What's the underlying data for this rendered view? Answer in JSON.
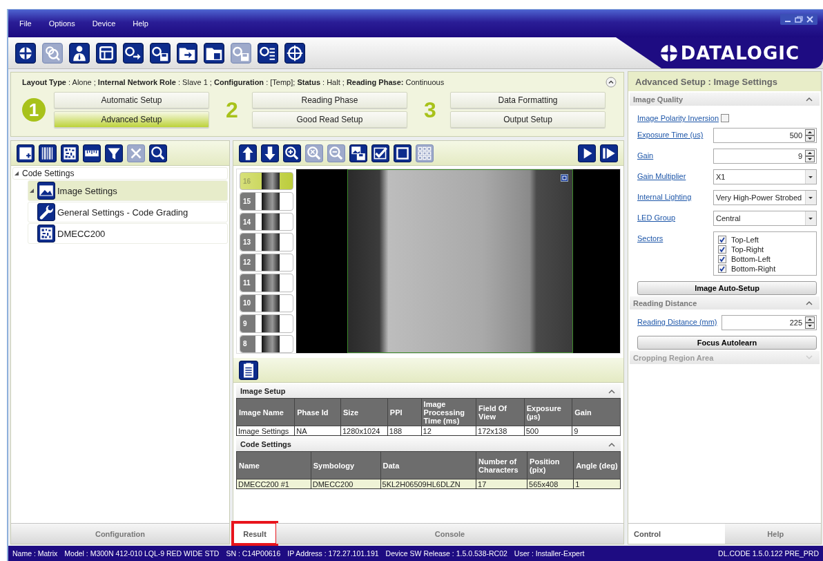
{
  "menu": [
    "File",
    "Options",
    "Device",
    "Help"
  ],
  "toolbar": [
    {
      "kind": "target",
      "disabled": false
    },
    {
      "kind": "camera-magnifier",
      "disabled": true
    },
    {
      "kind": "person",
      "disabled": false
    },
    {
      "kind": "window",
      "disabled": false
    },
    {
      "kind": "camera-arrow",
      "disabled": false
    },
    {
      "kind": "camera-disk",
      "disabled": false
    },
    {
      "kind": "folder-arrow",
      "disabled": false
    },
    {
      "kind": "folder-disk",
      "disabled": false
    },
    {
      "kind": "camera-disk",
      "disabled": true
    },
    {
      "kind": "camera-list",
      "disabled": false
    },
    {
      "kind": "crosshair",
      "disabled": false
    }
  ],
  "logo": {
    "text": "DATALOGIC"
  },
  "info_line": "**Layout Type** :  Alone ;  **Internal Network Role** :  Slave 1 ;  **Configuration** : [Temp];  **Status** :  Halt ;  **Reading Phase:** Continuous",
  "setup_steps": [
    {
      "number": "1",
      "active": true,
      "buttons": [
        {
          "label": "Automatic Setup",
          "selected": false
        },
        {
          "label": "Advanced Setup",
          "selected": true
        }
      ]
    },
    {
      "number": "2",
      "active": false,
      "buttons": [
        {
          "label": "Reading Phase",
          "selected": false
        },
        {
          "label": "Good Read Setup",
          "selected": false
        }
      ]
    },
    {
      "number": "3",
      "active": false,
      "buttons": [
        {
          "label": "Data Formatting",
          "selected": false
        },
        {
          "label": "Output Setup",
          "selected": false
        }
      ]
    }
  ],
  "config_panel": {
    "toolbar": [
      {
        "kind": "page-plus",
        "disabled": false
      },
      {
        "kind": "barcode",
        "disabled": false
      },
      {
        "kind": "matrix-code",
        "disabled": false
      },
      {
        "kind": "ruler",
        "disabled": false
      },
      {
        "kind": "funnel",
        "disabled": false
      },
      {
        "kind": "close",
        "disabled": true
      },
      {
        "kind": "magnifier",
        "disabled": false
      }
    ],
    "tree": [
      {
        "label": "Code Settings",
        "expanded": true,
        "children": [
          {
            "label": "Image Settings",
            "kind": "image",
            "selected": true,
            "expanded": true
          },
          {
            "label": "General Settings - Code Grading",
            "kind": "wrench",
            "selected": false
          },
          {
            "label": "DMECC200",
            "kind": "matrix-code",
            "selected": false
          }
        ]
      }
    ],
    "tab": "Configuration"
  },
  "viewer": {
    "toolbar": [
      {
        "kind": "arrow-up",
        "disabled": false
      },
      {
        "kind": "arrow-down",
        "disabled": false
      },
      {
        "kind": "zoom-in",
        "disabled": false
      },
      {
        "kind": "zoom-reset",
        "disabled": true
      },
      {
        "kind": "zoom-out",
        "disabled": true
      },
      {
        "kind": "picture-disk",
        "disabled": false
      },
      {
        "kind": "checkmark",
        "disabled": false
      },
      {
        "kind": "square",
        "disabled": false
      },
      {
        "kind": "grid",
        "disabled": true
      }
    ],
    "toolbar_right": [
      {
        "kind": "play",
        "disabled": false
      },
      {
        "kind": "step-forward",
        "disabled": false
      }
    ],
    "thumbnails": [
      {
        "label": "16",
        "selected": true
      },
      {
        "label": "15",
        "selected": false
      },
      {
        "label": "14",
        "selected": false
      },
      {
        "label": "13",
        "selected": false
      },
      {
        "label": "12",
        "selected": false
      },
      {
        "label": "11",
        "selected": false
      },
      {
        "label": "10",
        "selected": false
      },
      {
        "label": "9",
        "selected": false
      },
      {
        "label": "8",
        "selected": false
      }
    ]
  },
  "results": {
    "toolbar": [
      {
        "kind": "clipboard",
        "disabled": false
      }
    ],
    "sections": [
      {
        "title": "Image Setup",
        "expanded": true,
        "columns": [
          "Image Name",
          "Phase Id",
          "Size",
          "PPI",
          "Image Processing Time (ms)",
          "Field Of View",
          "Exposure (µs)",
          "Gain"
        ],
        "rows": [
          {
            "selected": false,
            "cells": [
              "Image Settings",
              "NA",
              "1280x1024",
              "188",
              "12",
              "172x138",
              "500",
              "9"
            ]
          }
        ]
      },
      {
        "title": "Code Settings",
        "expanded": true,
        "columns": [
          "Name",
          "Symbology",
          "Data",
          "Number of Characters",
          "Position (pix)",
          "Angle (deg)"
        ],
        "rows": [
          {
            "selected": true,
            "cells": [
              "DMECC200  #1",
              "DMECC200",
              "5KL2H06509HL6DLZN",
              "17",
              "565x408",
              "1"
            ]
          }
        ]
      }
    ],
    "tabs": [
      {
        "label": "Result",
        "selected": true,
        "highlighted": true
      },
      {
        "label": "Console",
        "selected": false,
        "highlighted": false
      }
    ]
  },
  "settings": {
    "title": "Advanced Setup :  Image Settings",
    "sections": [
      {
        "title": "Image Quality",
        "expanded": true,
        "disabled": false,
        "items": [
          {
            "kind": "checkbox",
            "label": "Image Polarity Inversion",
            "checked": false
          },
          {
            "kind": "spinner",
            "label": "Exposure Time (us)",
            "value": "500"
          },
          {
            "kind": "spinner",
            "label": "Gain",
            "value": "9"
          },
          {
            "kind": "dropdown",
            "label": "Gain Multiplier",
            "value": "X1"
          },
          {
            "kind": "dropdown",
            "label": "Internal Lighting",
            "value": "Very High-Power Strobed"
          },
          {
            "kind": "dropdown",
            "label": "LED Group",
            "value": "Central"
          },
          {
            "kind": "checklist",
            "label": "Sectors",
            "options": [
              {
                "label": "Top-Left",
                "checked": true
              },
              {
                "label": "Top-Right",
                "checked": true
              },
              {
                "label": "Bottom-Left",
                "checked": true
              },
              {
                "label": "Bottom-Right",
                "checked": true
              }
            ]
          },
          {
            "kind": "button",
            "label": "Image Auto-Setup"
          }
        ]
      },
      {
        "title": "Reading Distance",
        "expanded": true,
        "disabled": false,
        "items": [
          {
            "kind": "spinner",
            "label": "Reading Distance (mm)",
            "value": "225"
          },
          {
            "kind": "button",
            "label": "Focus Autolearn"
          }
        ]
      },
      {
        "title": "Cropping Region Area",
        "expanded": false,
        "disabled": true
      }
    ],
    "tabs": [
      {
        "label": "Control",
        "selected": true
      },
      {
        "label": "Help",
        "selected": false
      }
    ]
  },
  "status_bar": {
    "items": [
      "Name : Matrix",
      "Model : M300N 412-010 LQL-9 RED WIDE STD",
      "SN : C14P00616",
      "IP Address :  172.27.101.191",
      "Device SW Release : 1.5.0.538-RC02",
      "User : Installer-Expert"
    ],
    "version": "DL.CODE 1.5.0.122 PRE_PRD"
  }
}
